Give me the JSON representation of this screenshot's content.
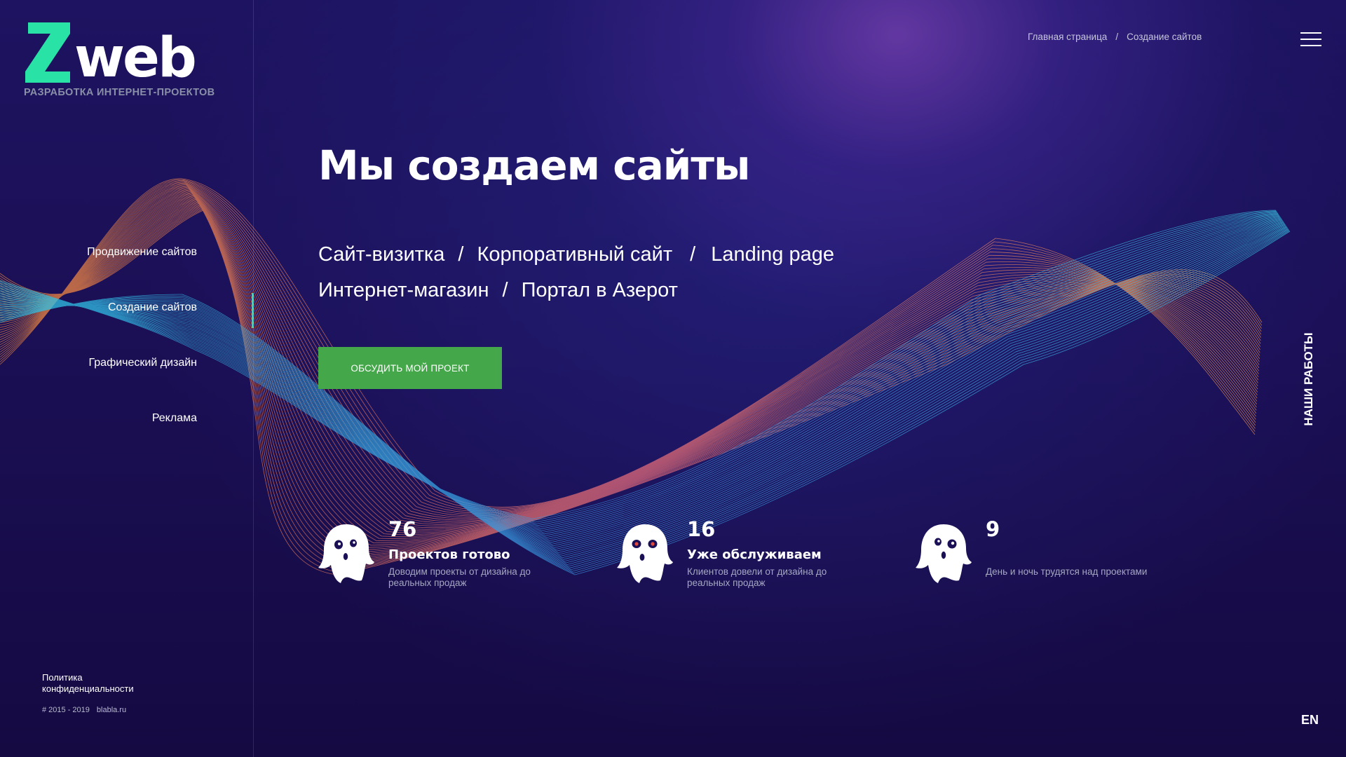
{
  "logo": {
    "brand_text": "Zweb",
    "tagline": "РАЗРАБОТКА ИНТЕРНЕТ-ПРОЕКТОВ",
    "accent_color": "#29e3a6"
  },
  "breadcrumb": {
    "items": [
      "Главная страница",
      "Создание сайтов"
    ],
    "separator": "/"
  },
  "menu": {
    "icon": "hamburger-icon"
  },
  "side_nav": {
    "items": [
      {
        "label": "Продвижение сайтов",
        "active": false
      },
      {
        "label": "Создание сайтов",
        "active": true
      },
      {
        "label": "Графический дизайн",
        "active": false
      },
      {
        "label": "Реклама",
        "active": false
      }
    ],
    "active_color": "#29e0b0"
  },
  "hero": {
    "title": "Мы создаем сайты",
    "services_row1": [
      "Сайт-визитка",
      "Корпоративный сайт",
      "Landing page"
    ],
    "services_row2": [
      "Интернет-магазин",
      "Портал в Азерот"
    ],
    "separator": "/",
    "cta_label": "ОБСУДИТЬ МОЙ ПРОЕКТ",
    "cta_color": "#44a84a"
  },
  "stats": [
    {
      "value": "76",
      "title": "Проектов готово",
      "description": "Доводим проекты от дизайна до реальных продаж",
      "icon": "ghost-icon"
    },
    {
      "value": "16",
      "title": "Уже обслуживаем",
      "description": "Клиентов  довели от дизайна до реальных продаж",
      "icon": "ghost-icon"
    },
    {
      "value": "9",
      "title": "",
      "description": "День и ночь трудятся над проектами",
      "icon": "ghost-icon"
    }
  ],
  "works_tab": "НАШИ РАБОТЫ",
  "language": "EN",
  "footer": {
    "privacy": "Политика конфиденциальности",
    "years": "# 2015 - 2019",
    "site": "blabla.ru"
  },
  "colors": {
    "background": "#1b0f55",
    "wave_warm": "#f08a3c",
    "wave_cool": "#2fc6e6"
  }
}
